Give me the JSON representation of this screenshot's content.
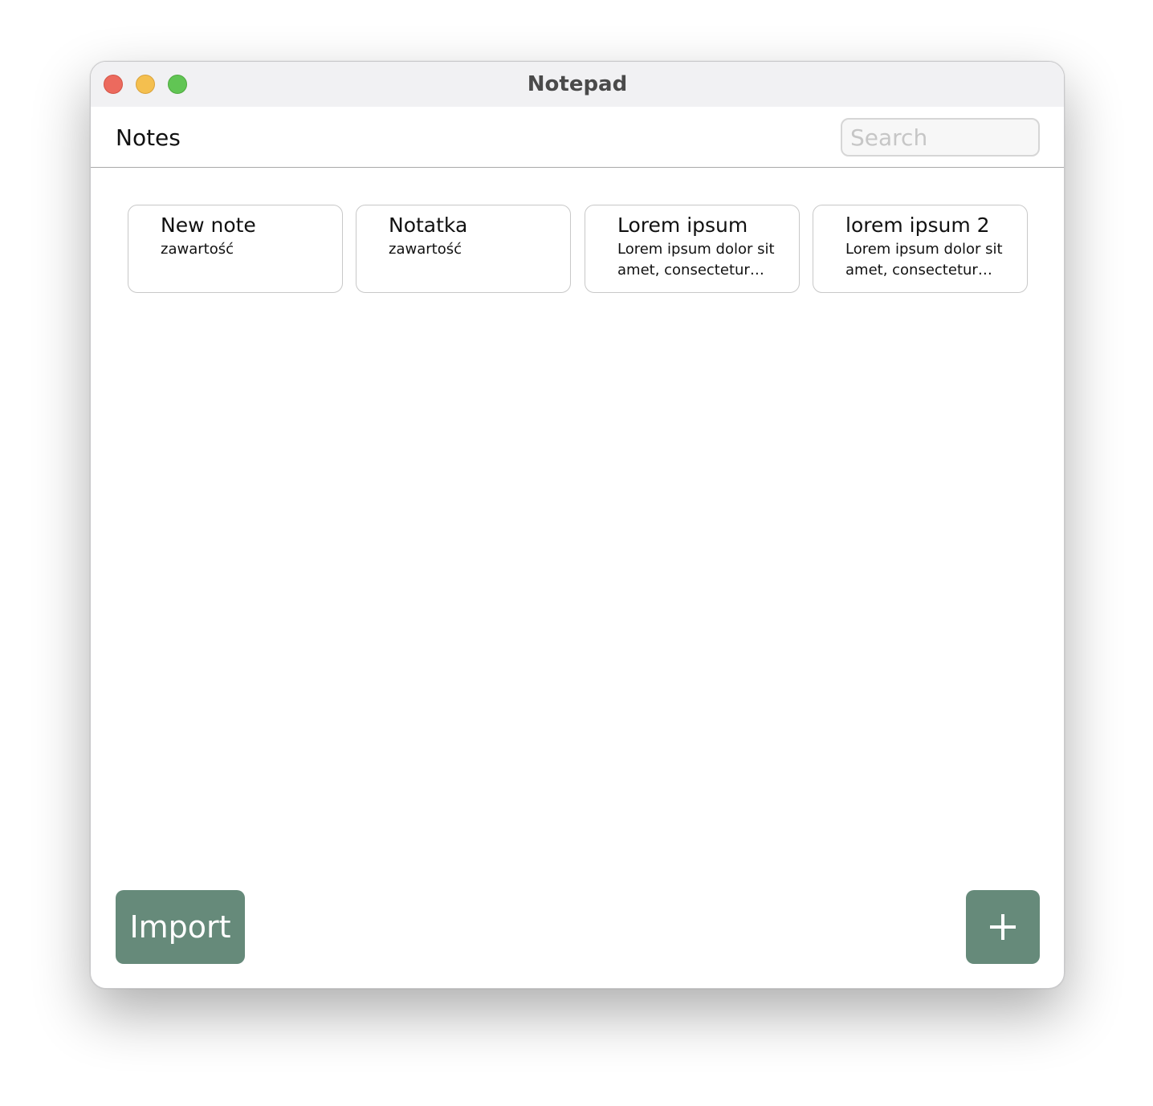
{
  "window": {
    "title": "Notepad"
  },
  "header": {
    "title": "Notes",
    "search_placeholder": "Search",
    "search_value": ""
  },
  "notes": [
    {
      "title": "New note",
      "body": "zawartość"
    },
    {
      "title": "Notatka",
      "body": "zawartość"
    },
    {
      "title": "Lorem ipsum",
      "body": "Lorem ipsum dolor sit amet, consectetur adipiscing elit"
    },
    {
      "title": "lorem ipsum 2",
      "body": "Lorem ipsum dolor sit amet, consectetur adipiscing elit"
    }
  ],
  "footer": {
    "import_label": "Import",
    "add_icon": "plus-icon"
  },
  "colors": {
    "accent": "#668a7a",
    "close": "#ec6a5e",
    "minimize": "#f4bf4f",
    "maximize": "#61c554"
  }
}
